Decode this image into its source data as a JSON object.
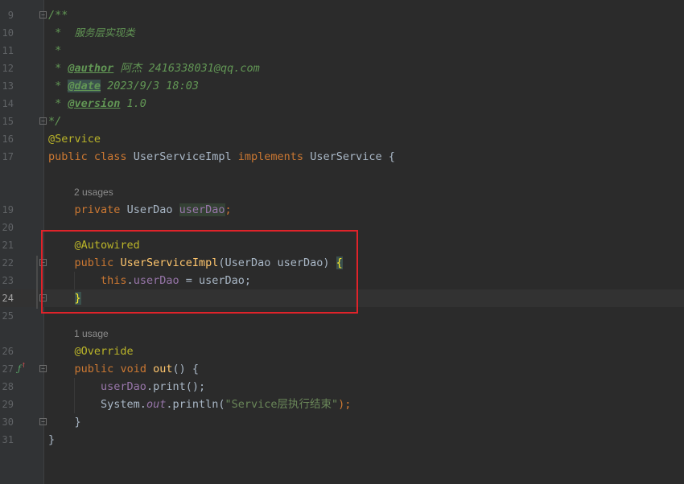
{
  "editor": {
    "line_numbers": [
      "9",
      "10",
      "11",
      "12",
      "13",
      "14",
      "15",
      "16",
      "17",
      "19",
      "20",
      "21",
      "22",
      "23",
      "24",
      "25",
      "26",
      "27",
      "28",
      "29",
      "30",
      "31"
    ],
    "current_line": "24",
    "doc": {
      "open": "/**",
      "desc_star": " *  ",
      "desc": "服务层实现类",
      "blank_star": " *",
      "author_star": " * ",
      "author_tag": "@author",
      "author_value": " 阿杰 2416338031@qq.com",
      "date_star": " * ",
      "date_tag": "@date",
      "date_value": " 2023/9/3 18:03",
      "version_star": " * ",
      "version_tag": "@version",
      "version_value": " 1.0",
      "close": "*/"
    },
    "service_annotation": "@Service",
    "class_decl": {
      "kw_public": "public",
      "kw_class": "class",
      "name": "UserServiceImpl",
      "kw_implements": "implements",
      "iface": "UserService",
      "brace": "{"
    },
    "hint_usages_2": "2 usages",
    "field_decl": {
      "kw_private": "private",
      "type": "UserDao",
      "name": "userDao",
      "semi": ";"
    },
    "autowired_annotation": "@Autowired",
    "ctor_decl": {
      "kw_public": "public",
      "name": "UserServiceImpl",
      "params": "(UserDao userDao) ",
      "brace": "{"
    },
    "ctor_body": {
      "kw_this": "this",
      "dot": ".",
      "field": "userDao",
      "rest": " = userDao;"
    },
    "ctor_close": "}",
    "hint_usages_1": "1 usage",
    "override_annotation": "@Override",
    "method_decl": {
      "kw_public": "public",
      "kw_void": "void",
      "name": "out",
      "rest": "() {"
    },
    "print_call": {
      "field": "userDao",
      "rest": ".print();"
    },
    "println_call": {
      "cls": "System.",
      "static_field": "out",
      "mid": ".println(",
      "str": "\"Service层执行结束\"",
      "end": ");"
    },
    "method_close": "}",
    "class_close": "}"
  },
  "gutter_icon": "fx-override-icon"
}
